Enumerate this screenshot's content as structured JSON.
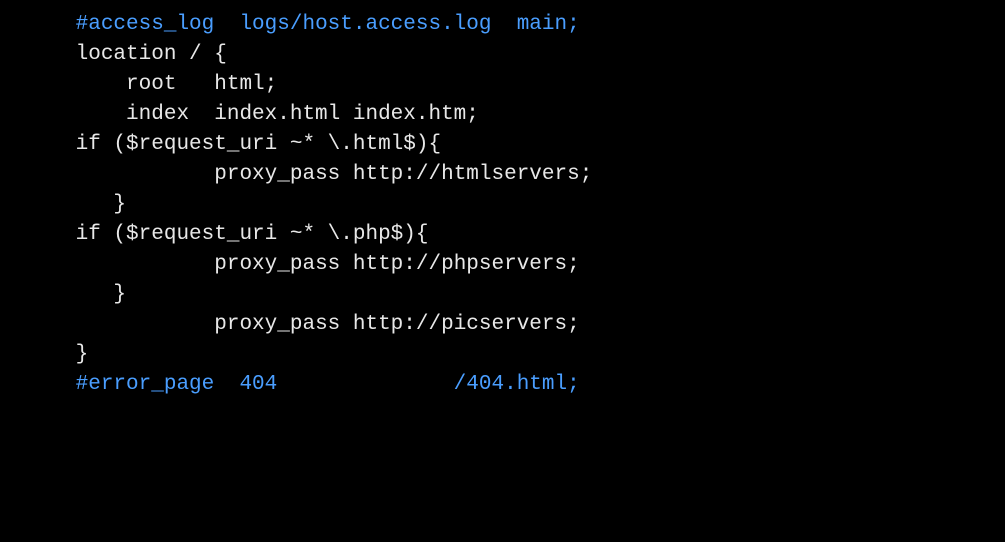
{
  "lines": [
    {
      "indent": "      ",
      "cls": "comment",
      "text": "#access_log  logs/host.access.log  main;"
    },
    {
      "indent": "",
      "cls": "normal",
      "text": ""
    },
    {
      "indent": "      ",
      "cls": "normal",
      "text": "location / {"
    },
    {
      "indent": "          ",
      "cls": "normal",
      "text": "root   html;"
    },
    {
      "indent": "          ",
      "cls": "normal",
      "text": "index  index.html index.htm;"
    },
    {
      "indent": "",
      "cls": "normal",
      "text": ""
    },
    {
      "indent": "",
      "cls": "normal",
      "text": ""
    },
    {
      "indent": "      ",
      "cls": "normal",
      "text": "if ($request_uri ~* \\.html$){"
    },
    {
      "indent": "                 ",
      "cls": "normal",
      "text": "proxy_pass http://htmlservers;"
    },
    {
      "indent": "         ",
      "cls": "normal",
      "text": "}"
    },
    {
      "indent": "      ",
      "cls": "normal",
      "text": "if ($request_uri ~* \\.php$){"
    },
    {
      "indent": "                 ",
      "cls": "normal",
      "text": "proxy_pass http://phpservers;"
    },
    {
      "indent": "         ",
      "cls": "normal",
      "text": "}"
    },
    {
      "indent": "                 ",
      "cls": "normal",
      "text": "proxy_pass http://picservers;"
    },
    {
      "indent": "",
      "cls": "normal",
      "text": ""
    },
    {
      "indent": "      ",
      "cls": "normal",
      "text": "}"
    },
    {
      "indent": "      ",
      "cls": "comment",
      "text": "#error_page  404              /404.html;"
    }
  ]
}
